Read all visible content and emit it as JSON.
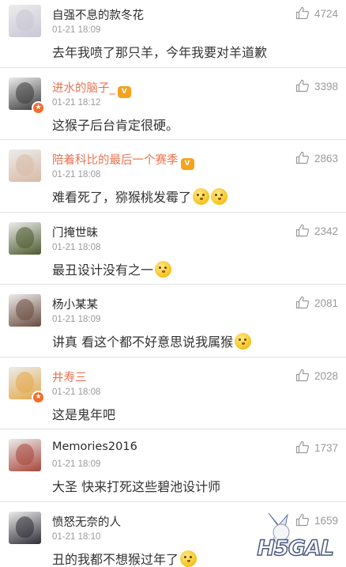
{
  "comments": [
    {
      "name": "自强不息的款冬花",
      "time": "01-21 18:09",
      "text": "去年我喷了那只羊，今年我要对羊道歉",
      "likes": "4724",
      "emojis": 0,
      "vip": false,
      "member": false,
      "avatar_color": "#c9c6d6"
    },
    {
      "name": "进水的脑子_",
      "time": "01-21 18:12",
      "text": "这猴子后台肯定很硬。",
      "likes": "3398",
      "emojis": 0,
      "vip": true,
      "member": true,
      "avatar_color": "#3b3b3b"
    },
    {
      "name": "陪着科比的最后一个赛季",
      "time": "01-21 18:08",
      "text": "难看死了，猕猴桃发霉了",
      "likes": "2863",
      "emojis": 2,
      "vip": false,
      "member": true,
      "avatar_color": "#d8b9a4"
    },
    {
      "name": "门掩世昧",
      "time": "01-21 18:08",
      "text": "最丑设计没有之一",
      "likes": "2342",
      "emojis": 1,
      "vip": false,
      "member": false,
      "avatar_color": "#4d5a2e"
    },
    {
      "name": "杨小某某",
      "time": "01-21 18:09",
      "text": "讲真 看这个都不好意思说我属猴",
      "likes": "2081",
      "emojis": 1,
      "vip": false,
      "member": false,
      "avatar_color": "#6a4b3e"
    },
    {
      "name": "井寿三",
      "time": "01-21 18:08",
      "text": "这是鬼年吧",
      "likes": "2028",
      "emojis": 0,
      "vip": true,
      "member": false,
      "avatar_color": "#e3a94a"
    },
    {
      "name": "Memories2016",
      "time": "01-21 18:09",
      "text": "大圣 快来打死这些碧池设计师",
      "likes": "1737",
      "emojis": 0,
      "vip": false,
      "member": false,
      "avatar_color": "#a8463a"
    },
    {
      "name": "愤怒无奈的人",
      "time": "01-21 18:10",
      "text": "丑的我都不想猴过年了",
      "likes": "1659",
      "emojis": 1,
      "vip": false,
      "member": false,
      "avatar_color": "#2d2d35"
    }
  ],
  "member_badge": "V",
  "vip_badge": "★",
  "watermark": "H5GAL",
  "icons": {
    "like": "thumbs-up-icon",
    "emoji": "smile-emoji-icon"
  },
  "colors": {
    "vip_name": "#eb7350",
    "meta": "#9a9a9a",
    "divider": "#e3e3e3"
  }
}
